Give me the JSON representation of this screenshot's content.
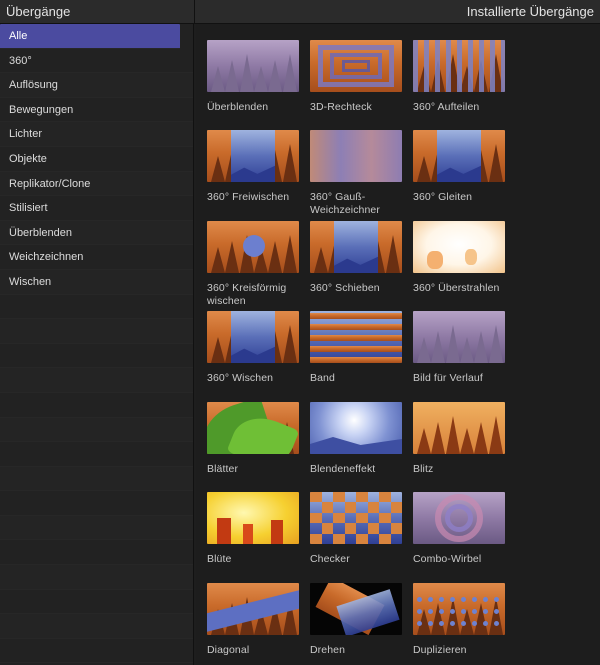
{
  "header": {
    "left_title": "Übergänge",
    "right_title": "Installierte Übergänge"
  },
  "sidebar": {
    "items": [
      {
        "label": "Alle",
        "selected": true
      },
      {
        "label": "360°"
      },
      {
        "label": "Auflösung"
      },
      {
        "label": "Bewegungen"
      },
      {
        "label": "Lichter"
      },
      {
        "label": "Objekte"
      },
      {
        "label": "Replikator/Clone"
      },
      {
        "label": "Stilisiert"
      },
      {
        "label": "Überblenden"
      },
      {
        "label": "Weichzeichnen"
      },
      {
        "label": "Wischen"
      }
    ]
  },
  "transitions": [
    {
      "label": "Überblenden",
      "thumb": "purple-forest"
    },
    {
      "label": "3D-Rechteck",
      "thumb": "nested-rects"
    },
    {
      "label": "360° Aufteilen",
      "thumb": "vertical-bars"
    },
    {
      "label": "360° Freiwischen",
      "thumb": "forest-blue-split"
    },
    {
      "label": "360° Gauß-Weichzeichner",
      "thumb": "blurred-purple"
    },
    {
      "label": "360° Gleiten",
      "thumb": "forest-blue-split"
    },
    {
      "label": "360° Kreisförmig wischen",
      "thumb": "circle-wipe"
    },
    {
      "label": "360° Schieben",
      "thumb": "forest-blue-split"
    },
    {
      "label": "360° Überstrahlen",
      "thumb": "white-bloom"
    },
    {
      "label": "360° Wischen",
      "thumb": "forest-blue-split"
    },
    {
      "label": "Band",
      "thumb": "horizontal-bands"
    },
    {
      "label": "Bild für Verlauf",
      "thumb": "purple-forest"
    },
    {
      "label": "Blätter",
      "thumb": "leaves"
    },
    {
      "label": "Blendeneffekt",
      "thumb": "lens-flare"
    },
    {
      "label": "Blitz",
      "thumb": "orange-forest"
    },
    {
      "label": "Blüte",
      "thumb": "yellow-bloom"
    },
    {
      "label": "Checker",
      "thumb": "checker"
    },
    {
      "label": "Combo-Wirbel",
      "thumb": "swirl"
    },
    {
      "label": "Diagonal",
      "thumb": "diagonal"
    },
    {
      "label": "Drehen",
      "thumb": "rotate"
    },
    {
      "label": "Duplizieren",
      "thumb": "duplicate"
    }
  ]
}
